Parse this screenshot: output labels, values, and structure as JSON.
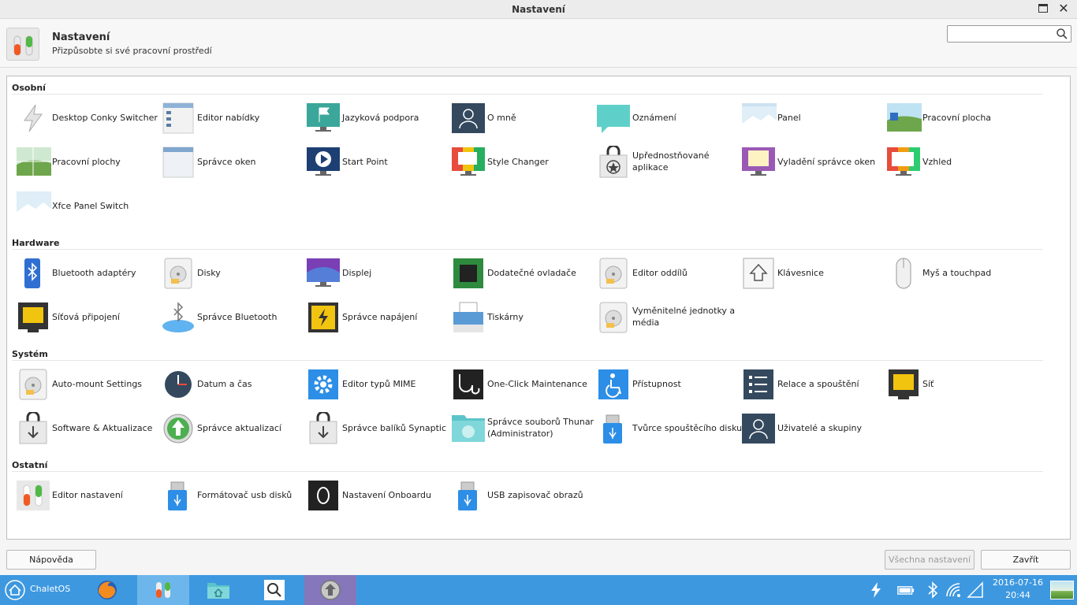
{
  "window": {
    "title": "Nastavení"
  },
  "header": {
    "title": "Nastavení",
    "subtitle": "Přizpůsobte si své pracovní prostředí"
  },
  "search": {
    "placeholder": "",
    "value": ""
  },
  "sections": {
    "personal": {
      "title": "Osobní",
      "items": [
        {
          "label": "Desktop Conky Switcher",
          "icon": "conky-icon"
        },
        {
          "label": "Editor nabídky",
          "icon": "menu-editor-icon"
        },
        {
          "label": "Jazyková podpora",
          "icon": "language-icon"
        },
        {
          "label": "O mně",
          "icon": "about-me-icon"
        },
        {
          "label": "Oznámení",
          "icon": "notifications-icon"
        },
        {
          "label": "Panel",
          "icon": "panel-icon"
        },
        {
          "label": "Pracovní plocha",
          "icon": "desktop-icon"
        },
        {
          "label": "Pracovní plochy",
          "icon": "workspaces-icon"
        },
        {
          "label": "Správce oken",
          "icon": "window-manager-icon"
        },
        {
          "label": "Start Point",
          "icon": "start-point-icon"
        },
        {
          "label": "Style Changer",
          "icon": "style-changer-icon"
        },
        {
          "label": "Upřednostňované aplikace",
          "icon": "preferred-apps-icon"
        },
        {
          "label": "Vyladění správce oken",
          "icon": "wm-tweaks-icon"
        },
        {
          "label": "Vzhled",
          "icon": "appearance-icon"
        },
        {
          "label": "Xfce Panel Switch",
          "icon": "panel-switch-icon"
        }
      ]
    },
    "hardware": {
      "title": "Hardware",
      "items": [
        {
          "label": "Bluetooth adaptéry",
          "icon": "bluetooth-adapter-icon"
        },
        {
          "label": "Disky",
          "icon": "disks-icon"
        },
        {
          "label": "Displej",
          "icon": "display-icon"
        },
        {
          "label": "Dodatečné ovladače",
          "icon": "drivers-icon"
        },
        {
          "label": "Editor oddílů",
          "icon": "partition-editor-icon"
        },
        {
          "label": "Klávesnice",
          "icon": "keyboard-icon"
        },
        {
          "label": "Myš a touchpad",
          "icon": "mouse-icon"
        },
        {
          "label": "Síťová připojení",
          "icon": "network-connections-icon"
        },
        {
          "label": "Správce Bluetooth",
          "icon": "bluetooth-manager-icon"
        },
        {
          "label": "Správce napájení",
          "icon": "power-manager-icon"
        },
        {
          "label": "Tiskárny",
          "icon": "printer-icon"
        },
        {
          "label": "Vyměnitelné jednotky a média",
          "icon": "removable-media-icon"
        }
      ]
    },
    "system": {
      "title": "Systém",
      "items": [
        {
          "label": "Auto-mount Settings",
          "icon": "automount-icon"
        },
        {
          "label": "Datum a čas",
          "icon": "clock-icon"
        },
        {
          "label": "Editor typů MIME",
          "icon": "mime-editor-icon"
        },
        {
          "label": "One-Click Maintenance",
          "icon": "maintenance-icon"
        },
        {
          "label": "Přístupnost",
          "icon": "accessibility-icon"
        },
        {
          "label": "Relace a spouštění",
          "icon": "session-icon"
        },
        {
          "label": "Síť",
          "icon": "network-icon"
        },
        {
          "label": "Software & Aktualizace",
          "icon": "software-updates-icon"
        },
        {
          "label": "Správce aktualizací",
          "icon": "update-manager-icon"
        },
        {
          "label": "Správce balíků Synaptic",
          "icon": "synaptic-icon"
        },
        {
          "label": "Správce souborů Thunar (Administrator)",
          "icon": "thunar-admin-icon"
        },
        {
          "label": "Tvůrce spouštěcího disku",
          "icon": "startup-disk-icon"
        },
        {
          "label": "Uživatelé a skupiny",
          "icon": "users-icon"
        }
      ]
    },
    "other": {
      "title": "Ostatní",
      "items": [
        {
          "label": "Editor nastavení",
          "icon": "settings-editor-icon"
        },
        {
          "label": "Formátovač usb disků",
          "icon": "usb-formatter-icon"
        },
        {
          "label": "Nastavení Onboardu",
          "icon": "onboard-icon"
        },
        {
          "label": "USB zapisovač obrazů",
          "icon": "usb-writer-icon"
        }
      ]
    }
  },
  "buttons": {
    "help": "Nápověda",
    "all_settings": "Všechna nastavení",
    "close": "Zavřít"
  },
  "taskbar": {
    "start_label": "ChaletOS",
    "date": "2016-07-16",
    "time": "20:44"
  }
}
